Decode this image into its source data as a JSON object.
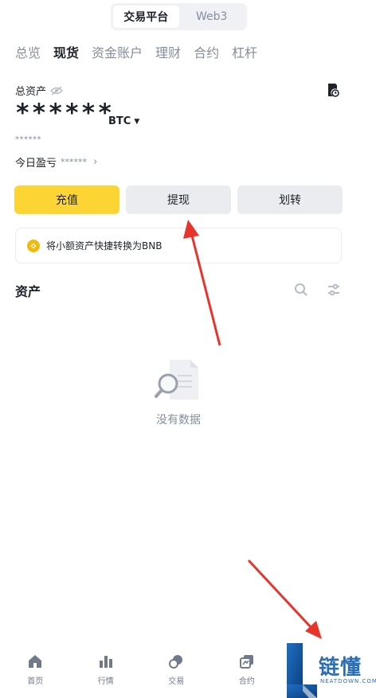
{
  "segment": {
    "options": [
      "交易平台",
      "Web3"
    ],
    "active": 0
  },
  "tabs": [
    {
      "label": "总览"
    },
    {
      "label": "现货"
    },
    {
      "label": "资金账户"
    },
    {
      "label": "理财"
    },
    {
      "label": "合约"
    },
    {
      "label": "杠杆"
    }
  ],
  "active_tab": "现货",
  "total": {
    "label": "总资产",
    "balance": "******",
    "currency": "BTC",
    "sub_balance": "******",
    "pnl_label": "今日盈亏",
    "pnl_value": "******"
  },
  "actions": {
    "deposit": "充值",
    "withdraw": "提现",
    "transfer": "划转"
  },
  "banner": {
    "text": "将小额资产快捷转换为BNB"
  },
  "assets": {
    "title": "资产",
    "empty_text": "没有数据"
  },
  "bottom_nav": [
    {
      "label": "首页",
      "icon": "home-icon"
    },
    {
      "label": "行情",
      "icon": "markets-icon"
    },
    {
      "label": "交易",
      "icon": "trade-icon"
    },
    {
      "label": "合约",
      "icon": "futures-icon"
    }
  ],
  "watermark": {
    "title": "链懂",
    "sub": "NEATDOWN.COM"
  },
  "colors": {
    "accent": "#fcd535",
    "arrow": "#e8352b",
    "muted": "#848e9c"
  }
}
